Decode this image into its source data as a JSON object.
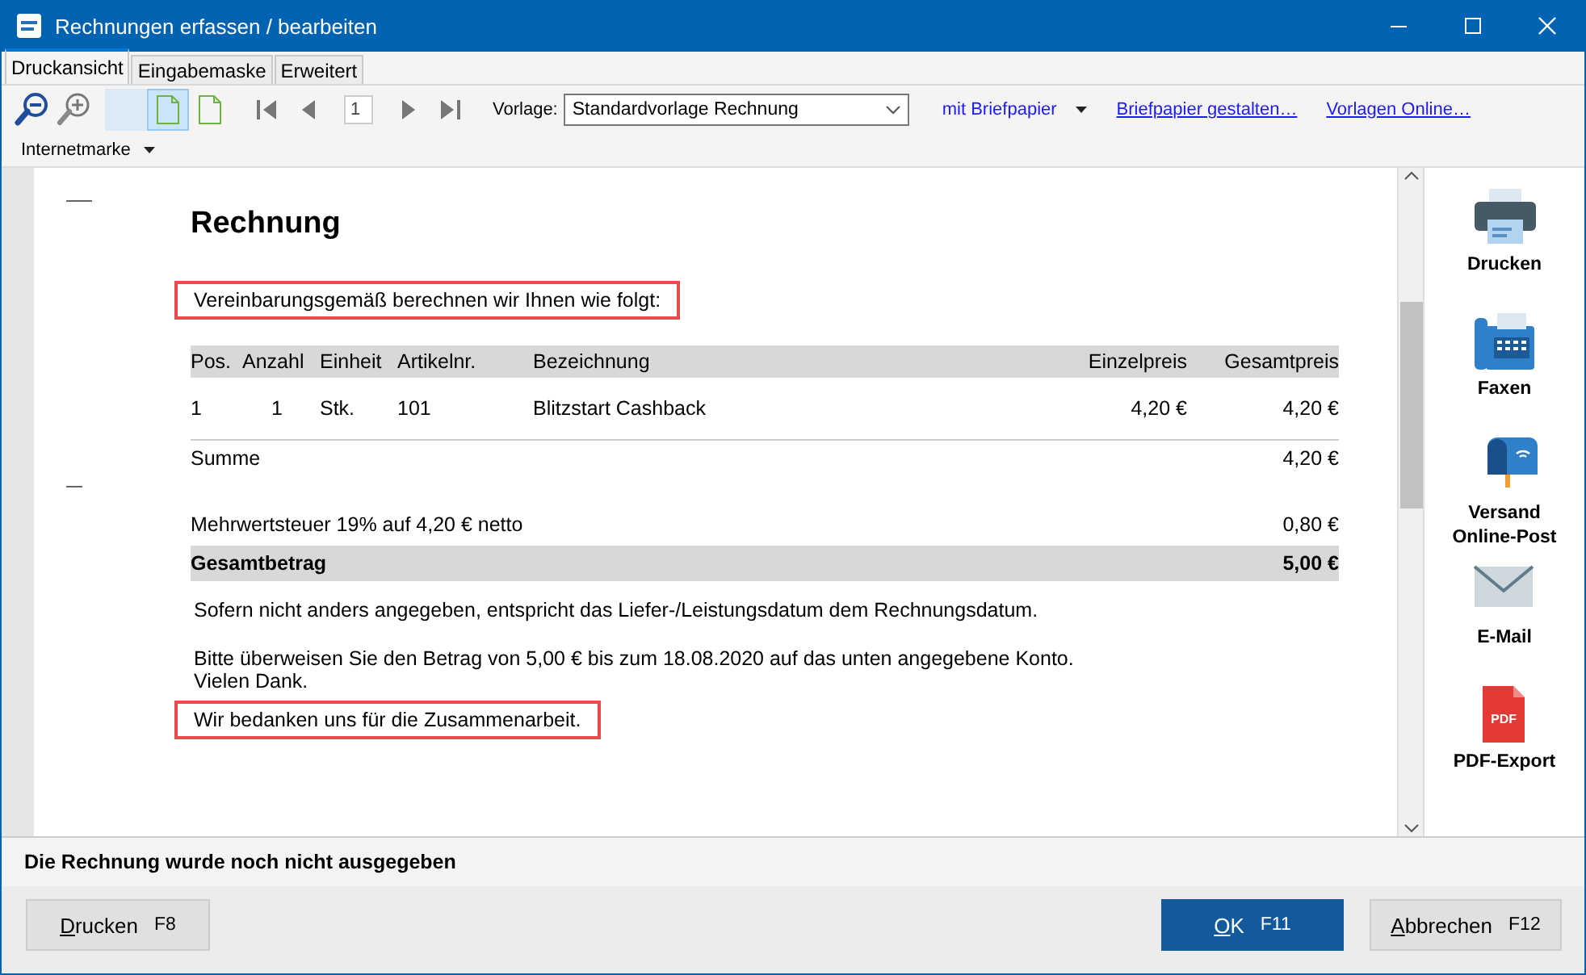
{
  "window": {
    "title": "Rechnungen erfassen / bearbeiten"
  },
  "tabs": [
    {
      "label": "Druckansicht",
      "selected": true
    },
    {
      "label": "Eingabemaske",
      "selected": false
    },
    {
      "label": "Erweitert",
      "selected": false
    }
  ],
  "toolbar": {
    "view_modes": [
      {
        "kind": "blank",
        "selected": false
      },
      {
        "kind": "page",
        "selected": true
      },
      {
        "kind": "page",
        "selected": false
      }
    ],
    "page": "1",
    "template_label": "Vorlage:",
    "template": "Standardvorlage Rechnung",
    "letterhead": "mit Briefpapier",
    "links": [
      "Briefpapier gestalten…",
      "Vorlagen Online…"
    ],
    "internetmarke": "Internetmarke"
  },
  "document": {
    "title": "Rechnung",
    "intro": {
      "text": "Vereinbarungsgemäß berechnen wir Ihnen wie folgt:",
      "highlighted": true
    },
    "columns": [
      "Pos.",
      "Anzahl",
      "Einheit",
      "Artikelnr.",
      "Bezeichnung",
      "Einzelpreis",
      "Gesamtpreis"
    ],
    "rows": [
      [
        "1",
        "1",
        "Stk.",
        "101",
        "Blitzstart Cashback",
        "4,20 €",
        "4,20 €"
      ]
    ],
    "sum": {
      "label": "Summe",
      "value": "4,20 €"
    },
    "tax": {
      "label": "Mehrwertsteuer 19% auf 4,20 € netto",
      "value": "0,80 €"
    },
    "total": {
      "label": "Gesamtbetrag",
      "value": "5,00 €"
    },
    "paragraphs": [
      {
        "text": "Sofern nicht anders angegeben, entspricht das Liefer-/Leistungsdatum dem Rechnungsdatum.",
        "highlighted": false
      },
      {
        "text": "Bitte überweisen Sie den Betrag von 5,00 € bis zum 18.08.2020 auf das unten angegebene Konto.\nVielen Dank.",
        "highlighted": false
      },
      {
        "text": "Wir bedanken uns für die Zusammenarbeit.",
        "highlighted": true
      }
    ]
  },
  "actions": [
    {
      "label": "Drucken",
      "kind": "printer"
    },
    {
      "label": "Faxen",
      "kind": "fax"
    },
    {
      "label": "Versand\nOnline-Post",
      "kind": "mailbox"
    },
    {
      "label": "E-Mail",
      "kind": "mail"
    },
    {
      "label": "PDF-Export",
      "kind": "pdf",
      "icon_text": "PDF"
    }
  ],
  "status": "Die Rechnung wurde noch nicht ausgegeben",
  "buttons": [
    {
      "label": "Drucken",
      "key": "F8",
      "kind": "default"
    },
    {
      "label": "OK",
      "key": "F11",
      "kind": "primary"
    },
    {
      "label": "Abbrechen",
      "key": "F12",
      "kind": "default"
    }
  ]
}
